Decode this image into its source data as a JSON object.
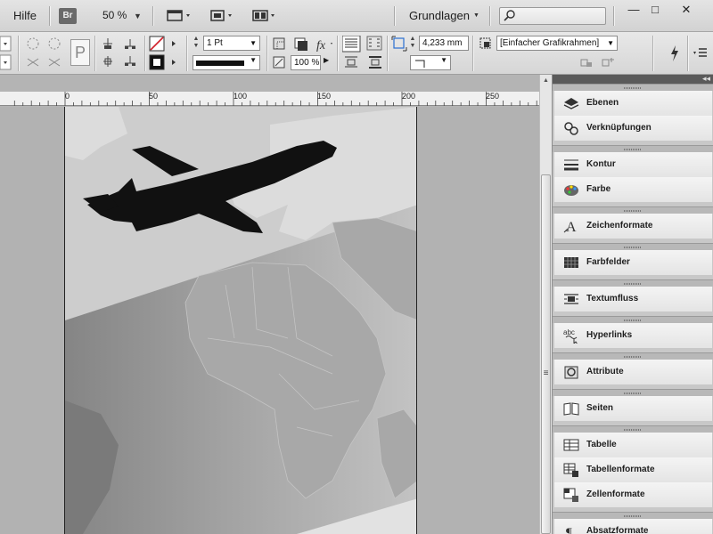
{
  "appbar": {
    "menu_help": "Hilfe",
    "bridge_label": "Br",
    "zoom_value": "50 %",
    "workspace": "Grundlagen",
    "window_buttons": {
      "minimize": "—",
      "maximize": "□",
      "close": "✕"
    }
  },
  "control": {
    "stroke_weight": "1 Pt",
    "opacity": "100 %",
    "corner_size": "4,233 mm",
    "object_style": "[Einfacher Grafikrahmen]"
  },
  "ruler": {
    "labels": [
      "0",
      "50",
      "100",
      "150",
      "200",
      "250"
    ]
  },
  "panels": [
    {
      "label": "Ebenen",
      "icon": "layers-icon"
    },
    {
      "label": "Verknüpfungen",
      "icon": "links-icon"
    },
    {
      "label": "Kontur",
      "icon": "stroke-icon"
    },
    {
      "label": "Farbe",
      "icon": "color-palette-icon"
    },
    {
      "label": "Zeichenformate",
      "icon": "character-styles-icon"
    },
    {
      "label": "Farbfelder",
      "icon": "swatches-icon"
    },
    {
      "label": "Textumfluss",
      "icon": "text-wrap-icon"
    },
    {
      "label": "Hyperlinks",
      "icon": "hyperlinks-icon"
    },
    {
      "label": "Attribute",
      "icon": "attributes-icon"
    },
    {
      "label": "Seiten",
      "icon": "pages-icon"
    },
    {
      "label": "Tabelle",
      "icon": "table-icon"
    },
    {
      "label": "Tabellenformate",
      "icon": "table-styles-icon"
    },
    {
      "label": "Zellenformate",
      "icon": "cell-styles-icon"
    },
    {
      "label": "Absatzformate",
      "icon": "paragraph-styles-icon"
    }
  ],
  "colors": {
    "dock_dark": "#5a5a5a",
    "panel_bg": "#f0f0f0",
    "page_light": "#cfcfcf",
    "airplane": "#111111"
  }
}
